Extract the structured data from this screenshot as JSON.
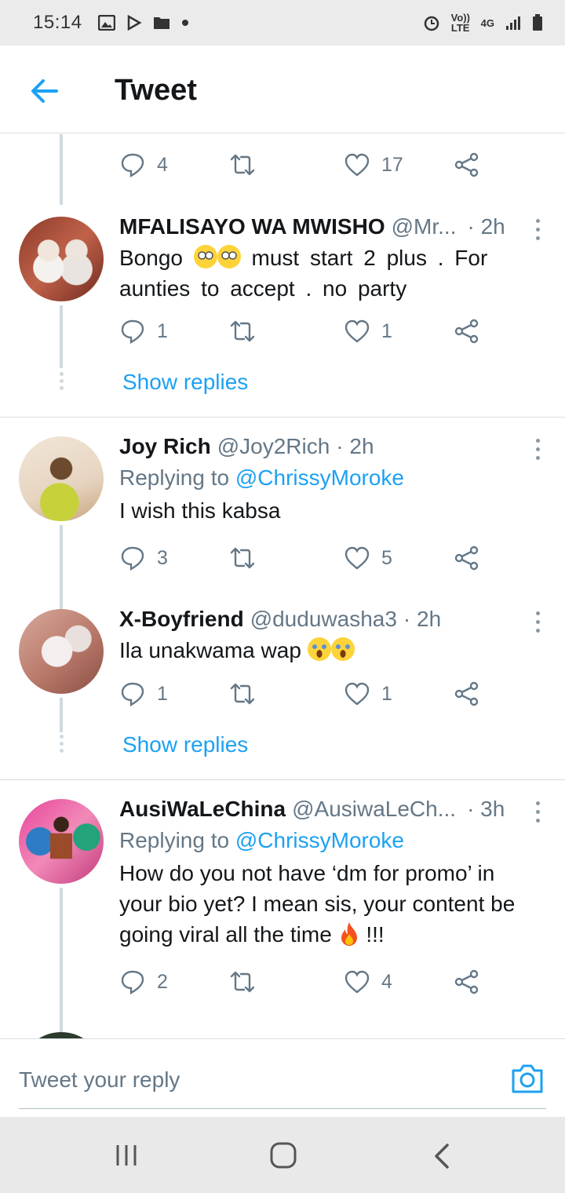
{
  "status_bar": {
    "time": "15:14",
    "volte": "Vo)) LTE",
    "network": "4G"
  },
  "header": {
    "title": "Tweet"
  },
  "top_tweet_actions": {
    "replies": "4",
    "likes": "17"
  },
  "tweets": [
    {
      "name": "MFALISAYO WA MWISHO",
      "handle": "@Mr...",
      "time": "· 2h",
      "text_a": "Bongo",
      "text_b": "must  start  2  plus  .  For aunties  to  accept .  no  party",
      "replies": "1",
      "likes": "1",
      "show_replies": "Show replies"
    },
    {
      "name": "Joy Rich",
      "handle": "@Joy2Rich",
      "time": "· 2h",
      "replying_prefix": "Replying to",
      "replying_to": "@ChrissyMoroke",
      "text": "I wish this kabsa",
      "replies": "3",
      "likes": "5"
    },
    {
      "name": "X-Boyfriend",
      "handle": "@duduwasha3",
      "time": "· 2h",
      "text": "Ila unakwama wap",
      "replies": "1",
      "likes": "1",
      "show_replies": "Show replies"
    },
    {
      "name": "AusiWaLeChina",
      "handle": "@AusiwaLeCh...",
      "time": "· 3h",
      "replying_prefix": "Replying to",
      "replying_to": "@ChrissyMoroke",
      "text": "How do you not have ‘dm for promo’ in your bio yet? I mean sis, your content be going viral all the time",
      "text_end": "!!!",
      "replies": "2",
      "likes": "4"
    }
  ],
  "reply_box": {
    "placeholder": "Tweet your reply"
  },
  "colors": {
    "accent": "#1da1f2",
    "secondary_text": "#657786",
    "border": "#d8dde1"
  },
  "icons": [
    "back-arrow-icon",
    "reply-icon",
    "retweet-icon",
    "like-icon",
    "share-icon",
    "more-icon",
    "camera-icon"
  ]
}
